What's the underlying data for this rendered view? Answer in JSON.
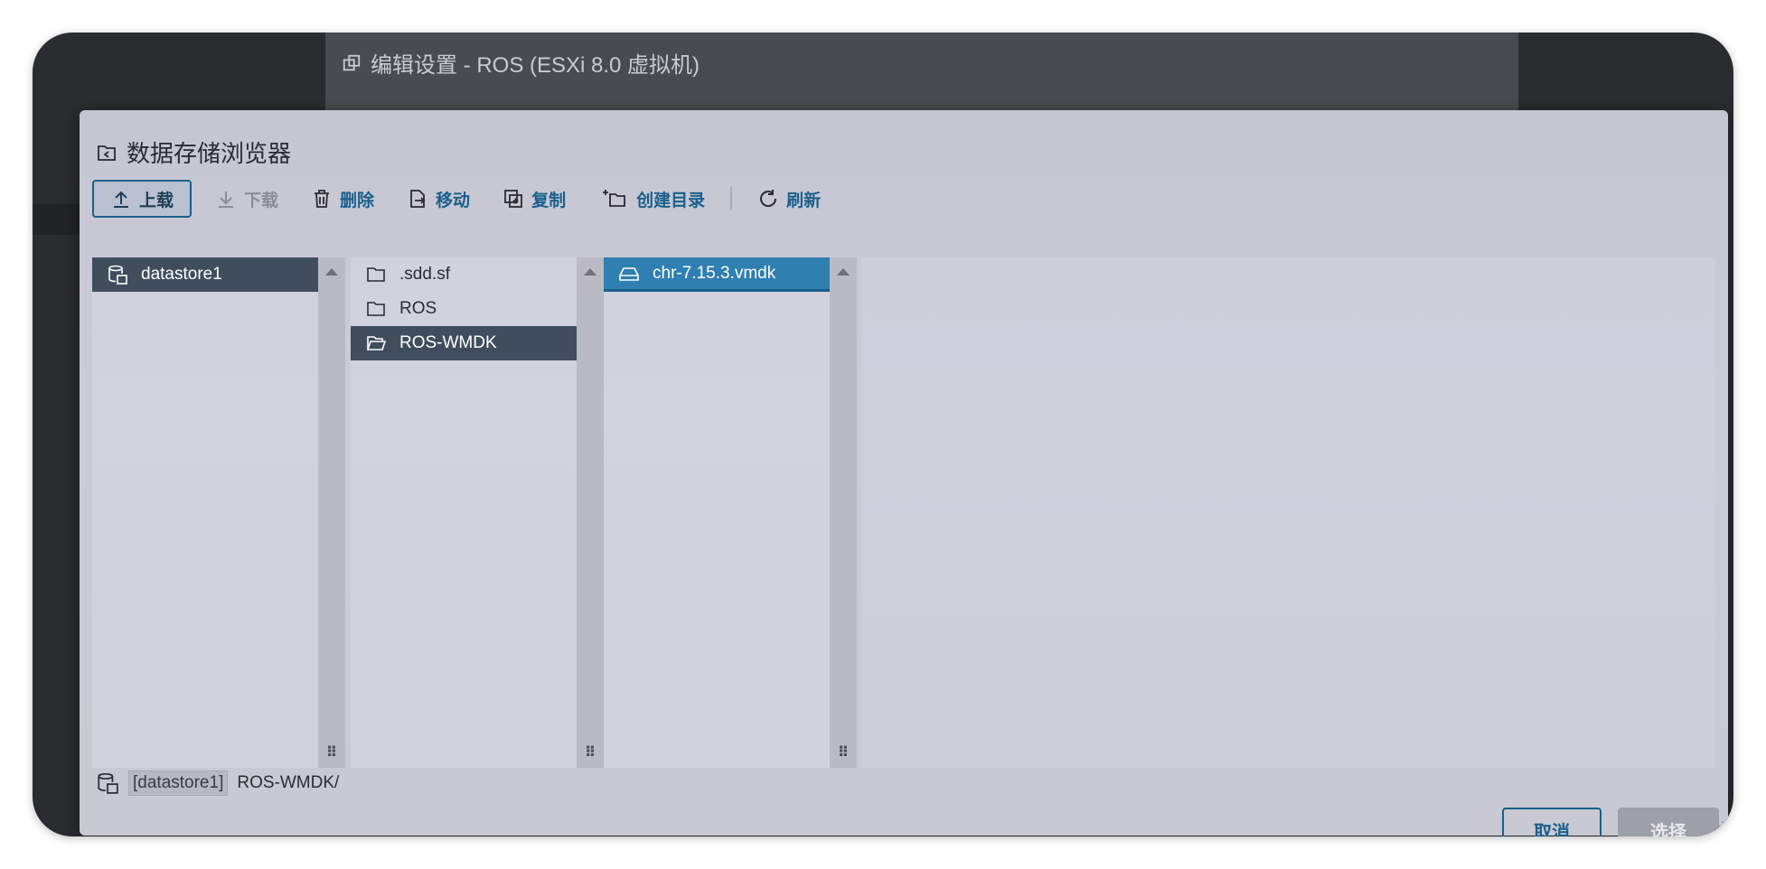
{
  "background": {
    "modal_title": "编辑设置 - ROS (ESXi 8.0 虚拟机)"
  },
  "dialog": {
    "title": "数据存储浏览器",
    "title_icon": "datastore-browser-icon"
  },
  "toolbar": {
    "upload": "上载",
    "download": "下载",
    "delete": "删除",
    "move": "移动",
    "copy": "复制",
    "create_dir": "创建目录",
    "refresh": "刷新"
  },
  "columns": {
    "datastores": [
      {
        "label": "datastore1",
        "icon": "datastore-icon",
        "selected": true
      }
    ],
    "folders": [
      {
        "label": ".sdd.sf",
        "icon": "folder-icon",
        "selected": false
      },
      {
        "label": "ROS",
        "icon": "folder-icon",
        "selected": false
      },
      {
        "label": "ROS-WMDK",
        "icon": "folder-open-icon",
        "selected": true
      }
    ],
    "files": [
      {
        "label": "chr-7.15.3.vmdk",
        "icon": "disk-icon",
        "selected": true
      }
    ]
  },
  "path": {
    "datastore": "[datastore1]",
    "folder": "ROS-WMDK/"
  },
  "actions": {
    "cancel": "取消",
    "select": "选择"
  },
  "colors": {
    "accent": "#1b5f8c",
    "selection_dark": "#3f4d5d",
    "selection_blue": "#2f7fb0"
  }
}
